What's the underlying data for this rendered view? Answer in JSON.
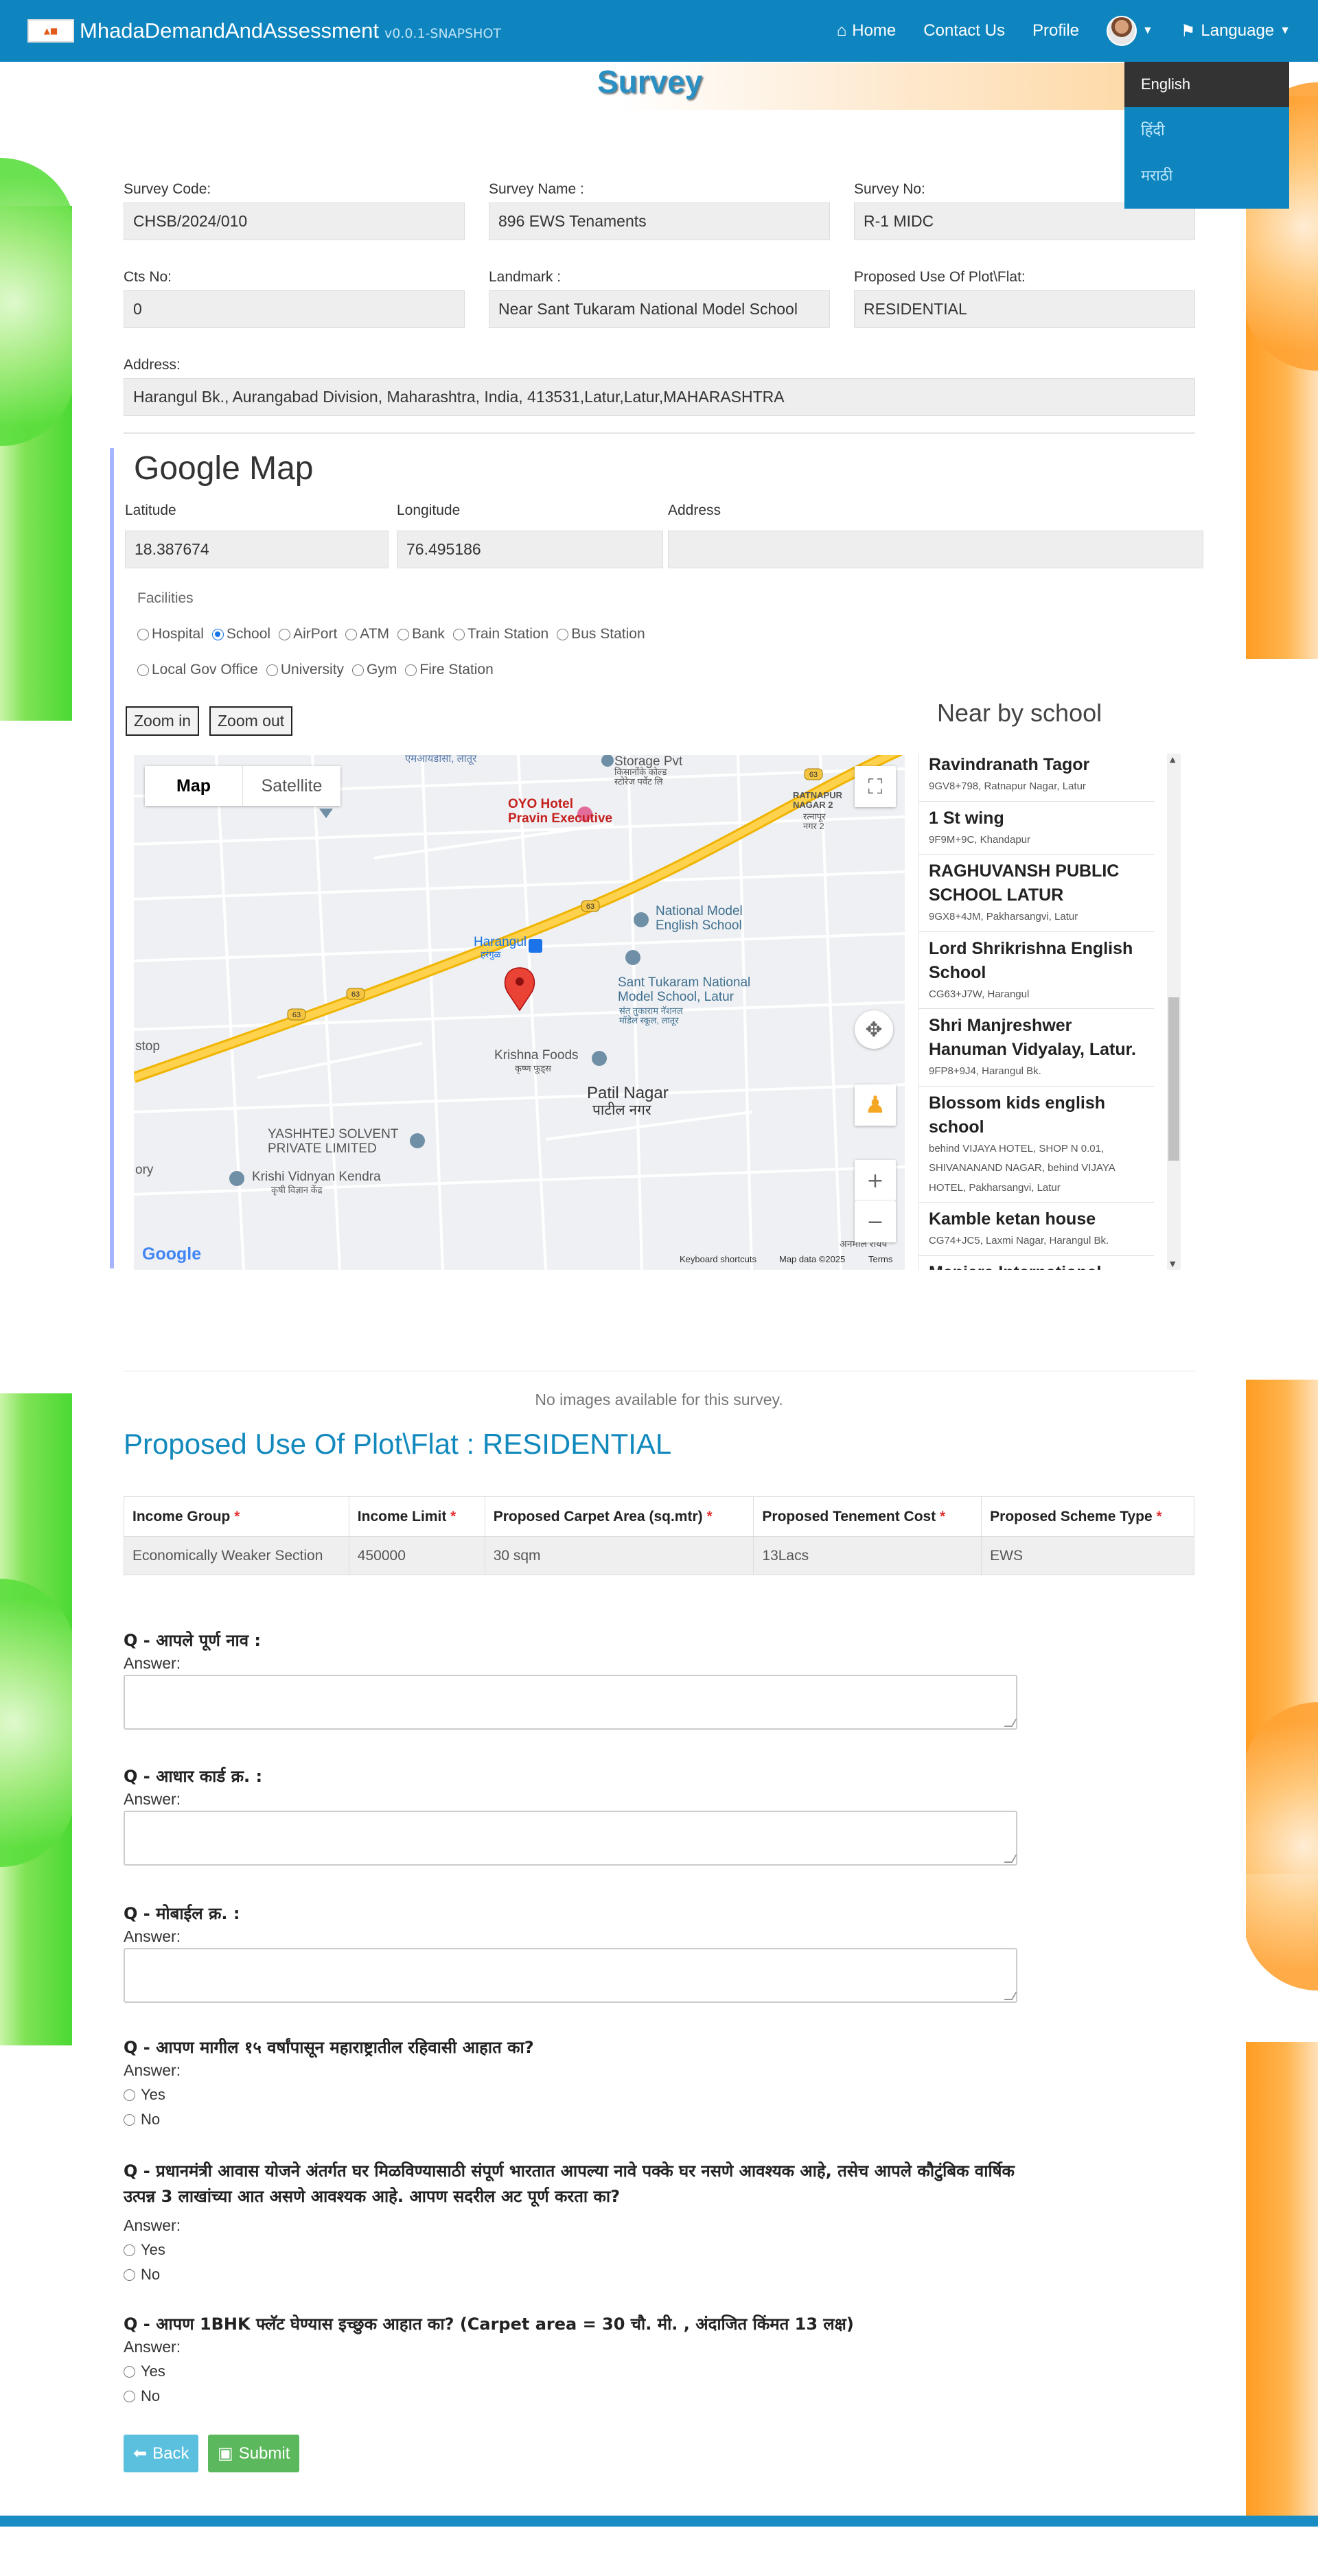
{
  "navbar": {
    "brand": "MhadaDemandAndAssessment",
    "version": "v0.0.1-SNAPSHOT",
    "links": [
      "Home",
      "Contact Us",
      "Profile"
    ],
    "language_label": "Language"
  },
  "language_menu": [
    "English",
    "हिंदी",
    "मराठी"
  ],
  "page_title": "Survey",
  "survey": {
    "code_label": "Survey Code:",
    "code": "CHSB/2024/010",
    "name_label": "Survey Name :",
    "name": "896 EWS Tenaments",
    "no_label": "Survey No:",
    "no": "R-1 MIDC",
    "cts_label": "Cts No:",
    "cts": "0",
    "landmark_label": "Landmark :",
    "landmark": "Near Sant Tukaram National Model School",
    "use_label": "Proposed Use Of Plot\\Flat:",
    "use": "RESIDENTIAL",
    "address_label": "Address:",
    "address": "Harangul Bk., Aurangabad Division, Maharashtra, India, 413531,Latur,Latur,MAHARASHTRA"
  },
  "map_section": {
    "title": "Google Map",
    "lat_label": "Latitude",
    "lat": "18.387674",
    "lng_label": "Longitude",
    "lng": "76.495186",
    "addr_label": "Address",
    "addr": "",
    "facilities_label": "Facilities",
    "facilities_row1": [
      "Hospital",
      "School",
      "AirPort",
      "ATM",
      "Bank",
      "Train Station",
      "Bus Station"
    ],
    "facilities_row2": [
      "Local Gov Office",
      "University",
      "Gym",
      "Fire Station"
    ],
    "selected_facility": "School",
    "zoom_in": "Zoom in",
    "zoom_out": "Zoom out",
    "map_tab_map": "Map",
    "map_tab_satellite": "Satellite",
    "map_labels": {
      "hotel": "OYO Hotel\nPravin Executive",
      "school": "National Model\nEnglish School",
      "sant": "Sant Tukaram National\nModel School, Latur",
      "sant_mr": "संत तुकाराम नॅशनल\nमॉडेल स्कूल, लातूर",
      "harangul": "Harangul",
      "harangul_mr": "हरंगुळ",
      "krishna": "Krishna Foods",
      "krishna_mr": "कृष्ण फूड्स",
      "patil": "Patil Nagar",
      "patil_mr": "पाटील नगर",
      "yashtej": "YASHHTEJ SOLVENT\nPRIVATE LIMITED",
      "krishi": "Krishi Vidnyan Kendra",
      "krishi_mr": "कृषी विज्ञान केंद्र",
      "ratnapur": "RATNAPUR\nNAGAR 2",
      "ratnapur_mr": "रत्नापूर\nनगर 2",
      "storage": "Storage Pvt",
      "storage_mr": "किसानोंके कोल्ड\nस्टोरेज पर्वेट लि",
      "mr_top": "एमआयडीसी, लातूर",
      "stop": "stop",
      "ory": "ory",
      "anmal": "अनमाल रायप",
      "hw63": "63"
    },
    "map_footer": {
      "logo": "Google",
      "shortcuts": "Keyboard shortcuts",
      "data": "Map data ©2025",
      "terms": "Terms"
    },
    "nearby_title": "Near by school",
    "nearby": [
      {
        "name": "Ravindranath Tagor",
        "addr": "9GV8+798, Ratnapur Nagar, Latur"
      },
      {
        "name": "1 St wing",
        "addr": "9F9M+9C, Khandapur"
      },
      {
        "name": "RAGHUVANSH PUBLIC SCHOOL LATUR",
        "addr": "9GX8+4JM, Pakharsangvi, Latur"
      },
      {
        "name": "Lord Shrikrishna English School",
        "addr": "CG63+J7W, Harangul"
      },
      {
        "name": "Shri Manjreshwer Hanuman Vidyalay, Latur.",
        "addr": "9FP8+9J4, Harangul Bk."
      },
      {
        "name": "Blossom kids english school",
        "addr": "behind VIJAYA HOTEL, SHOP N 0.01, SHIVANANAND NAGAR, behind VIJAYA HOTEL, Pakharsangvi, Latur"
      },
      {
        "name": "Kamble ketan house",
        "addr": "CG74+JC5, Laxmi Nagar, Harangul Bk."
      },
      {
        "name": "Manjara International",
        "addr": ""
      }
    ]
  },
  "no_images": "No images available for this survey.",
  "proposed_title": "Proposed Use Of Plot\\Flat : RESIDENTIAL",
  "table": {
    "headers": [
      "Income Group",
      "Income Limit",
      "Proposed Carpet Area (sq.mtr)",
      "Proposed Tenement Cost",
      "Proposed Scheme Type"
    ],
    "row": [
      "Economically Weaker Section",
      "450000",
      "30 sqm",
      "13Lacs",
      "EWS"
    ]
  },
  "questions": [
    {
      "q": "Q - आपले पूर्ण नाव :",
      "type": "text"
    },
    {
      "q": "Q - आधार कार्ड क्र. :",
      "type": "text"
    },
    {
      "q": "Q - मोबाईल क्र. :",
      "type": "text"
    },
    {
      "q": "Q - आपण मागील १५ वर्षांपासून महाराष्ट्रातील रहिवासी आहात का?",
      "type": "radio"
    },
    {
      "q": "Q - प्रधानमंत्री आवास योजने अंतर्गत घर मिळविण्यासाठी संपूर्ण भारतात आपल्या नावे पक्के घर नसणे आवश्यक आहे, तसेच आपले कौटुंबिक वार्षिक उत्पन्न 3 लाखांच्या आत असणे आवश्यक आहे. आपण सदरील अट पूर्ण करता का?",
      "type": "radio"
    },
    {
      "q": "Q - आपण 1BHK फ्लॅट घेण्यास इच्छुक आहात का? (Carpet area = 30 चौ. मी. , अंदाजित किंमत 13 लक्ष)",
      "type": "radio"
    }
  ],
  "answer_label": "Answer:",
  "yes": "Yes",
  "no": "No",
  "buttons": {
    "back": "Back",
    "submit": "Submit"
  }
}
